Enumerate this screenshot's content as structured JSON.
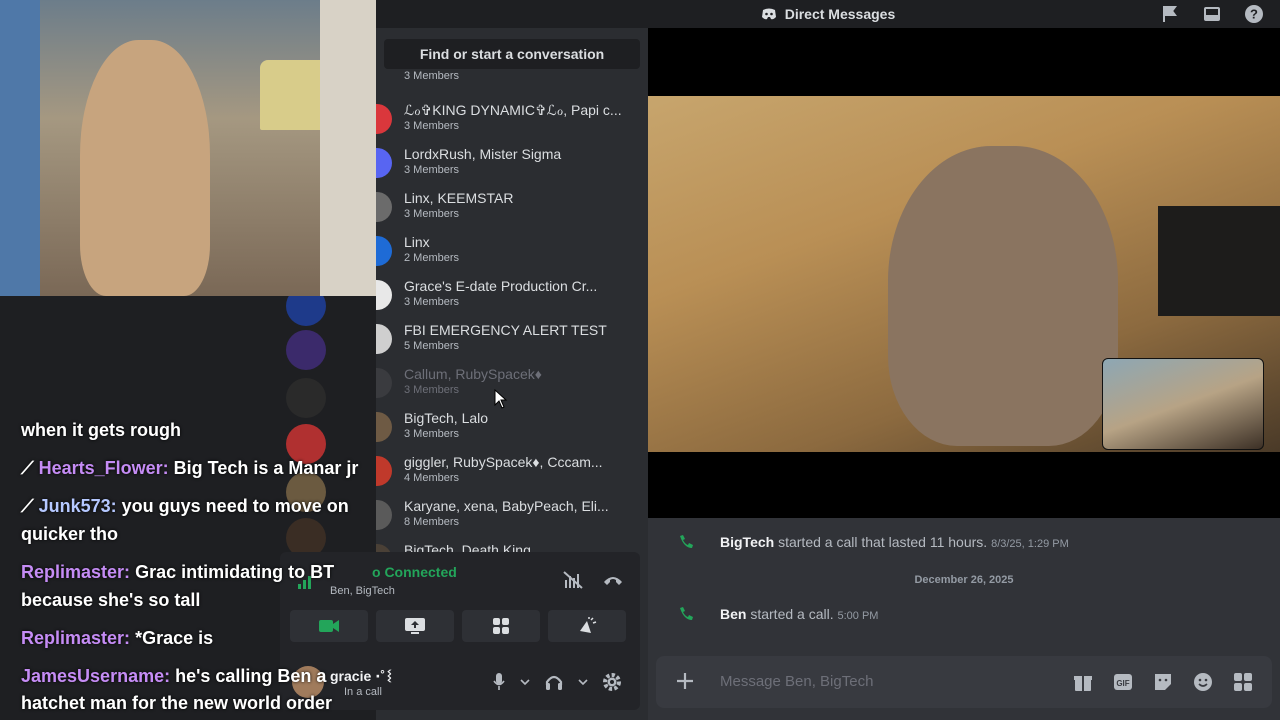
{
  "topbar": {
    "title": "Direct Messages"
  },
  "search": {
    "label": "Find or start a conversation"
  },
  "dm_list": {
    "partial_top": "3 Members",
    "items": [
      {
        "name": "ℒℴ✞KING DYNAMIC✞ℒℴ, Papi c...",
        "members": "3 Members"
      },
      {
        "name": "LordxRush, Mister Sigma",
        "members": "3 Members"
      },
      {
        "name": "Linx, KEEMSTAR",
        "members": "3 Members"
      },
      {
        "name": "Linx",
        "members": "2 Members"
      },
      {
        "name": "Grace's E-date Production Cr...",
        "members": "3 Members"
      },
      {
        "name": "FBI EMERGENCY ALERT TEST",
        "members": "5 Members"
      },
      {
        "name": "Callum, RubySpacek♦",
        "members": "3 Members"
      },
      {
        "name": "BigTech, Lalo",
        "members": "3 Members"
      },
      {
        "name": "giggler, RubySpacek♦, Cccam...",
        "members": "4 Members"
      },
      {
        "name": "Karyane, xena, BabyPeach, Eli...",
        "members": "8 Members"
      },
      {
        "name": "BigTech, Death King",
        "members": ""
      }
    ]
  },
  "voice": {
    "status": "o Connected",
    "participants": "Ben, BigTech"
  },
  "user": {
    "name": "gracie ⋅˚ᛵ",
    "status": "In a call"
  },
  "chat": {
    "messages": [
      {
        "author": "BigTech",
        "text": "started a call that lasted 11 hours.",
        "time": "8/3/25, 1:29 PM"
      },
      {
        "author": "Ben",
        "text": "started a call.",
        "time": "5:00 PM"
      }
    ],
    "date_divider": "December 26, 2025",
    "composer_placeholder": "Message Ben, BigTech"
  },
  "stream_chat": [
    {
      "user": "",
      "text": "when it gets rough"
    },
    {
      "user": "Hearts_Flower:",
      "text": "Big Tech is a Manar jr"
    },
    {
      "user": "Junk573:",
      "text": "you guys need to move on"
    },
    {
      "user": "",
      "text": "quicker tho"
    },
    {
      "user": "Replimaster:",
      "text": "Grac intimidating to BT"
    },
    {
      "user": "",
      "text": "because she's so tall"
    },
    {
      "user": "Replimaster:",
      "text": "*Grace is"
    },
    {
      "user": "JamesUsername:",
      "text": "he's calling Ben a"
    },
    {
      "user": "",
      "text": "hatchet man for the new world order"
    }
  ],
  "colors": {
    "accent_green": "#23a55a",
    "chat_username": "#c58cf5",
    "background": "#1e1f22"
  }
}
